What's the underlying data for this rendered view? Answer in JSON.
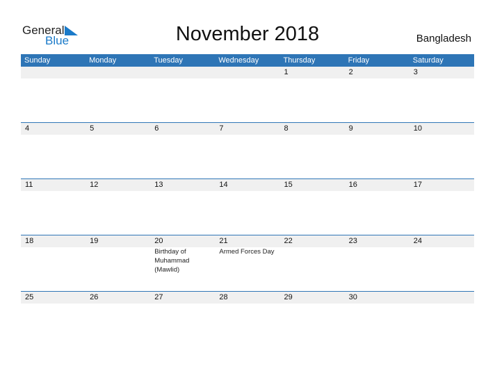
{
  "logo": {
    "general": "General",
    "blue": "Blue"
  },
  "title": "November 2018",
  "country": "Bangladesh",
  "colors": {
    "header": "#2e75b6",
    "shade": "#f0f0f0",
    "logo_blue": "#1a7ac9"
  },
  "weekdays": [
    "Sunday",
    "Monday",
    "Tuesday",
    "Wednesday",
    "Thursday",
    "Friday",
    "Saturday"
  ],
  "weeks": [
    [
      {
        "d": ""
      },
      {
        "d": ""
      },
      {
        "d": ""
      },
      {
        "d": ""
      },
      {
        "d": "1"
      },
      {
        "d": "2"
      },
      {
        "d": "3"
      }
    ],
    [
      {
        "d": "4"
      },
      {
        "d": "5"
      },
      {
        "d": "6"
      },
      {
        "d": "7"
      },
      {
        "d": "8"
      },
      {
        "d": "9"
      },
      {
        "d": "10"
      }
    ],
    [
      {
        "d": "11"
      },
      {
        "d": "12"
      },
      {
        "d": "13"
      },
      {
        "d": "14"
      },
      {
        "d": "15"
      },
      {
        "d": "16"
      },
      {
        "d": "17"
      }
    ],
    [
      {
        "d": "18"
      },
      {
        "d": "19"
      },
      {
        "d": "20",
        "h": "Birthday of Muhammad (Mawlid)"
      },
      {
        "d": "21",
        "h": "Armed Forces Day"
      },
      {
        "d": "22"
      },
      {
        "d": "23"
      },
      {
        "d": "24"
      }
    ],
    [
      {
        "d": "25"
      },
      {
        "d": "26"
      },
      {
        "d": "27"
      },
      {
        "d": "28"
      },
      {
        "d": "29"
      },
      {
        "d": "30"
      },
      {
        "d": ""
      }
    ]
  ]
}
